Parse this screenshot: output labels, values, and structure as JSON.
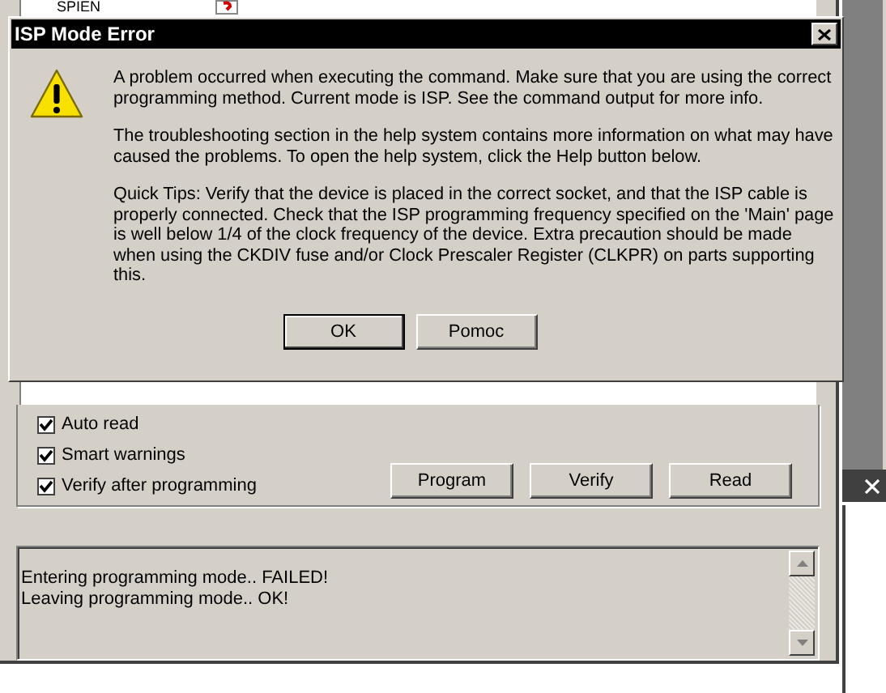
{
  "background_window": {
    "list_row": {
      "name": "SPIEN"
    },
    "options": [
      {
        "label": "Auto read",
        "checked": true
      },
      {
        "label": "Smart warnings",
        "checked": true
      },
      {
        "label": "Verify after programming",
        "checked": true
      }
    ],
    "buttons": [
      "Program",
      "Verify",
      "Read"
    ],
    "log": [
      "Entering programming mode.. FAILED!",
      "Leaving programming mode.. OK!"
    ]
  },
  "dialog": {
    "title": "ISP Mode Error",
    "paragraphs": [
      "A problem occurred when executing the command. Make sure that you are using the correct programming method. Current mode is ISP. See the command output for more info.",
      "The troubleshooting section in the help system contains more information on what may have caused the problems. To open the help system, click the Help button below.",
      "Quick Tips: Verify that the device is placed in the correct socket, and that the ISP cable is properly connected. Check that the ISP programming frequency specified on the 'Main' page is well below 1/4 of the clock frequency of the device. Extra precaution should be made when using the CKDIV fuse and/or Clock Prescaler Register (CLKPR) on parts supporting this."
    ],
    "buttons": [
      {
        "label": "OK",
        "default": true
      },
      {
        "label": "Pomoc",
        "default": false
      }
    ]
  }
}
